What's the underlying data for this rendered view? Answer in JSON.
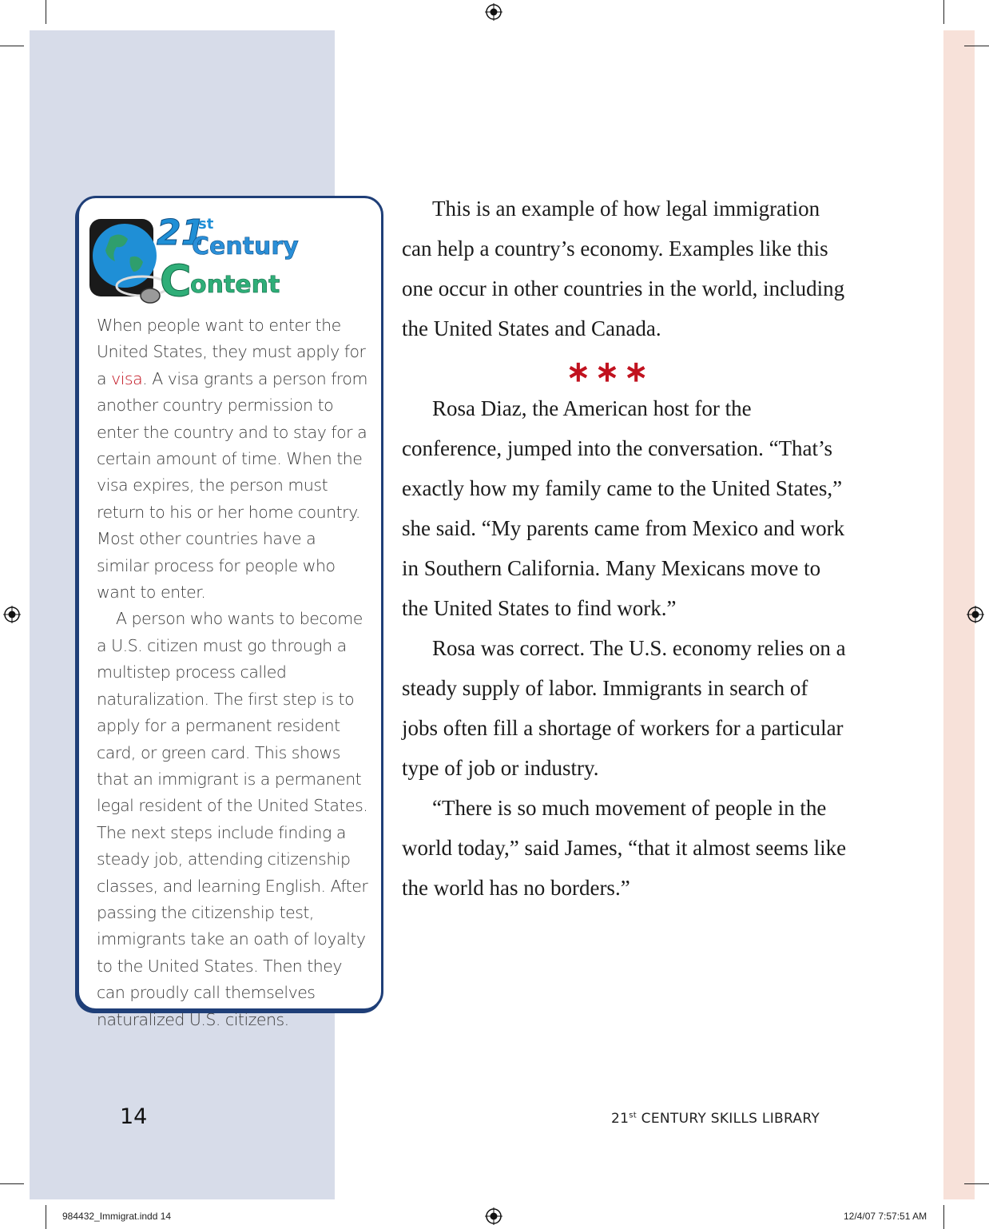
{
  "sidebar": {
    "logo": {
      "line1": "21",
      "line1_sup": "st",
      "line2": "Century",
      "line3": "Content",
      "icon": "globe-with-mouse-icon"
    },
    "paragraph1_before": "When people want to enter the United States, they must apply for a ",
    "glossary_term": "visa",
    "paragraph1_after": ". A visa grants a person from another country permission to enter the country and to stay for a certain amount of time. When the visa expires, the person must return to his or her home country. Most other countries have a similar process for people who want to enter.",
    "paragraph2": "A person who wants to become a U.S. citizen must go through a multistep process called naturalization. The first step is to apply for a permanent resident card, or green card. This shows that an immigrant is a permanent legal resident of the United States. The next steps include finding a steady job, attending citizenship classes, and learning English. After passing the citizenship test, immigrants take an oath of loyalty to the United States. Then they can proudly call themselves naturalized U.S. citizens."
  },
  "main": {
    "p1": "This is an example of how legal immigration can help a country’s economy. Examples like this one occur in other countries in the world, including the United States and Canada.",
    "separator": "∗∗∗",
    "p2": "Rosa Diaz, the American host for the conference, jumped into the conversation. “That’s exactly how my family came to the United States,” she said. “My parents came from Mexico and work in Southern California. Many Mexicans move to the United States to find work.”",
    "p3": "Rosa was correct. The U.S. economy relies on a steady supply of labor. Immigrants in search of jobs often fill a shortage of workers for a particular type of job or industry.",
    "p4": "“There is so much movement of people in the world today,” said James, “that it almost seems like the world has no borders.”"
  },
  "footer": {
    "page_number": "14",
    "series_prefix": "21",
    "series_sup": "st",
    "series_rest": " CENTURY SKILLS LIBRARY"
  },
  "slug": {
    "file": "984432_Immigrat.indd   14",
    "timestamp": "12/4/07   7:57:51 AM"
  },
  "colors": {
    "left_panel": "#d7dce9",
    "right_strip": "#f7e1d9",
    "sidebar_border": "#1f3f78",
    "accent_red": "#c1121f"
  }
}
